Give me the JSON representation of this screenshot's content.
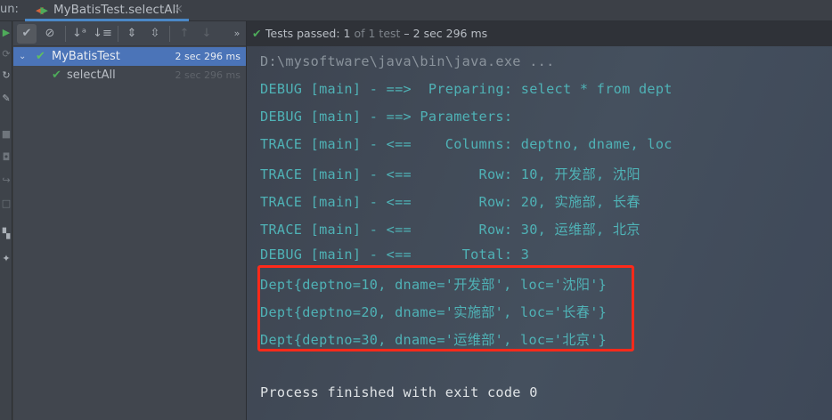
{
  "topbar": {
    "run_label": "un:",
    "tab_title": "MyBatisTest.selectAll",
    "close": "×"
  },
  "toolbar": {
    "expand_more": "»"
  },
  "tree": [
    {
      "name": "MyBatisTest",
      "time": "2 sec 296 ms",
      "status": "passed"
    },
    {
      "name": "selectAll",
      "time": "2 sec 296 ms",
      "status": "passed"
    }
  ],
  "status": {
    "label": "Tests passed:",
    "passed": "1",
    "of_total": "of 1 test",
    "duration": "– 2 sec 296 ms"
  },
  "console": {
    "lines": [
      "D:\\mysoftware\\java\\bin\\java.exe ...",
      "DEBUG [main] - ==>  Preparing: select * from dept",
      "DEBUG [main] - ==> Parameters: ",
      "TRACE [main] - <==    Columns: deptno, dname, loc",
      "TRACE [main] - <==        Row: 10, 开发部, 沈阳",
      "TRACE [main] - <==        Row: 20, 实施部, 长春",
      "TRACE [main] - <==        Row: 30, 运维部, 北京",
      "DEBUG [main] - <==      Total: 3",
      "Dept{deptno=10, dname='开发部', loc='沈阳'}",
      "Dept{deptno=20, dname='实施部', loc='长春'}",
      "Dept{deptno=30, dname='运维部', loc='北京'}",
      "Process finished with exit code 0"
    ]
  },
  "colors": {
    "accent": "#4b74b8",
    "pass": "#4eab5a",
    "console_text": "#4fb2b6",
    "highlight": "#ff2a1a"
  }
}
